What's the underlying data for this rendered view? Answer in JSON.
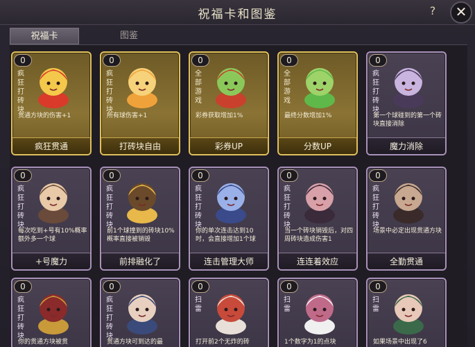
{
  "window": {
    "title": "祝福卡和图鉴",
    "help_label": "?",
    "close_label": "✕"
  },
  "tabs": [
    {
      "label": "祝福卡",
      "active": true
    },
    {
      "label": "图鉴",
      "active": false
    }
  ],
  "cards": [
    {
      "count": "0",
      "tag": "疯狂打砖块",
      "desc": "贯通方块的伤害+1",
      "name": "疯狂贯通",
      "frame": "gold",
      "icon": "money-god-icon"
    },
    {
      "count": "0",
      "tag": "疯狂打砖块",
      "desc": "所有球伤害+1",
      "name": "打砖块自由",
      "frame": "gold",
      "icon": "tiger-costume-icon"
    },
    {
      "count": "0",
      "tag": "全部游戏",
      "desc": "彩券获取增加1%",
      "name": "彩券UP",
      "frame": "gold",
      "icon": "dragon-rider-icon"
    },
    {
      "count": "0",
      "tag": "全部游戏",
      "desc": "最终分数增加1%",
      "name": "分数UP",
      "frame": "gold",
      "icon": "green-dragon-icon"
    },
    {
      "count": "0",
      "tag": "疯狂打砖块",
      "desc": "第一个球碰到的第一个砖块直接消除",
      "name": "魔力消除",
      "frame": "purple",
      "icon": "mage-girl-icon"
    },
    {
      "count": "0",
      "tag": "疯狂打砖块",
      "desc": "每次吃到+号有10%概率额外多一个球",
      "name": "+号魔力",
      "frame": "purple",
      "icon": "brown-hair-girl-icon"
    },
    {
      "count": "0",
      "tag": "疯狂打砖块",
      "desc": "前1个球撞到的砖块10%概率直接被销毁",
      "name": "前排融化了",
      "frame": "purple",
      "icon": "golden-halo-girl-icon"
    },
    {
      "count": "0",
      "tag": "疯狂打砖块",
      "desc": "你的单次连击达到10时，会直接增加1个球",
      "name": "连击管理大师",
      "frame": "purple",
      "icon": "blue-robe-girl-icon"
    },
    {
      "count": "0",
      "tag": "疯狂打砖块",
      "desc": "当一个砖块销毁后，对四周砖块造成伤害1",
      "name": "连连着效应",
      "frame": "purple",
      "icon": "warrior-girl-icon"
    },
    {
      "count": "0",
      "tag": "疯狂打砖块",
      "desc": "场景中必定出现贯通方块",
      "name": "全勤贯通",
      "frame": "purple",
      "icon": "masked-girl-icon"
    },
    {
      "count": "0",
      "tag": "疯狂打砖块",
      "desc": "你的贯通方块被贯",
      "name": "",
      "frame": "purple",
      "icon": "golden-general-icon"
    },
    {
      "count": "0",
      "tag": "疯狂打砖块",
      "desc": "贯通方块可到达的最",
      "name": "",
      "frame": "purple",
      "icon": "blue-scholar-icon"
    },
    {
      "count": "0",
      "tag": "扫雷",
      "desc": "打开前2个无炸的砖",
      "name": "",
      "frame": "purple",
      "icon": "white-priestess-icon"
    },
    {
      "count": "0",
      "tag": "扫雷",
      "desc": "1个数字为1的点块",
      "name": "",
      "frame": "purple",
      "icon": "white-hair-girl-icon"
    },
    {
      "count": "0",
      "tag": "扫雷",
      "desc": "如果场景中出现了6",
      "name": "",
      "frame": "purple",
      "icon": "green-ribbon-girl-icon"
    }
  ],
  "colors": {
    "gold_frame": "#e0c05c",
    "purple_frame": "#a992b8",
    "background": "#221f29"
  }
}
